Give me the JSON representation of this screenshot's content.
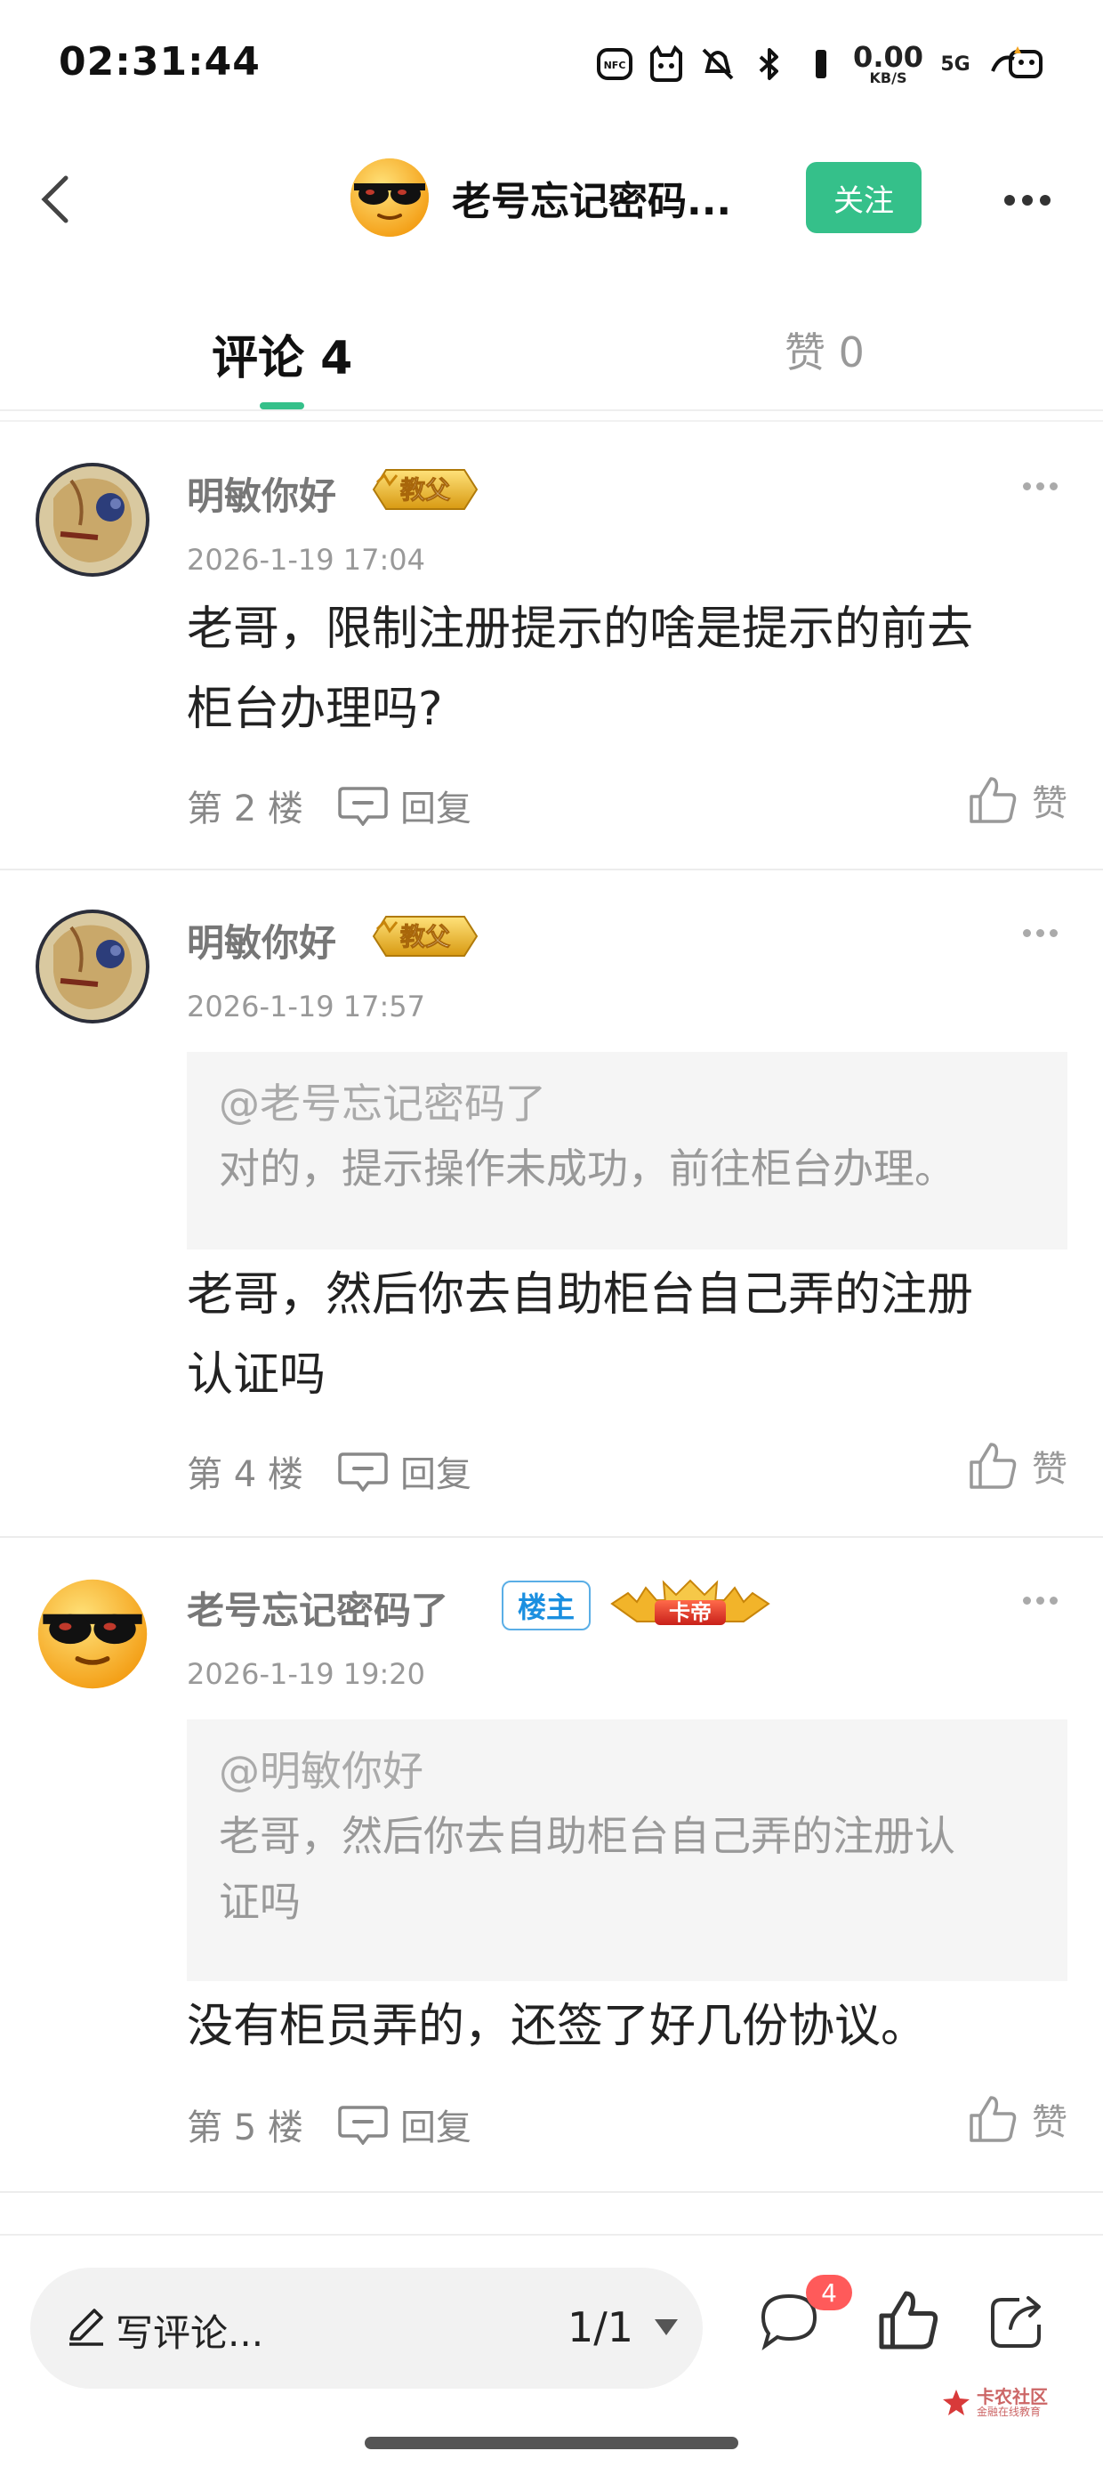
{
  "status_bar": {
    "time": "02:31:44",
    "nfc": "NFC",
    "net_speed": "0.00",
    "net_unit": "KB/S",
    "network": "5G",
    "icons": [
      "nfc-icon",
      "cat-icon",
      "mute-icon",
      "bluetooth-icon",
      "signal-icon",
      "battery-icon"
    ]
  },
  "header": {
    "title": "老号忘记密码...",
    "follow_label": "关注"
  },
  "tabs": {
    "comments_label": "评论 4",
    "likes_label": "赞 0"
  },
  "comments": [
    {
      "user": "明敏你好",
      "badge": "教父",
      "date": "2026-1-19 17:04",
      "content_line1": "老哥，限制注册提示的啥是提示的前去",
      "content_line2": "柜台办理吗?",
      "floor": "第 2 楼",
      "reply_label": "回复",
      "like_label": "赞"
    },
    {
      "user": "明敏你好",
      "badge": "教父",
      "date": "2026-1-19 17:57",
      "quote_user": "@老号忘记密码了",
      "quote_text": "对的，提示操作未成功，前往柜台办理。",
      "content_line1": "老哥，然后你去自助柜台自己弄的注册",
      "content_line2": "认证吗",
      "floor": "第 4 楼",
      "reply_label": "回复",
      "like_label": "赞"
    },
    {
      "user": "老号忘记密码了",
      "badge_owner": "楼主",
      "badge": "卡帝",
      "date": "2026-1-19 19:20",
      "quote_user": "@明敏你好",
      "quote_line1": "老哥，然后你去自助柜台自己弄的注册认",
      "quote_line2": "证吗",
      "content_line1": "没有柜员弄的，还签了好几份协议。",
      "floor": "第 5 楼",
      "reply_label": "回复",
      "like_label": "赞"
    }
  ],
  "bottom_bar": {
    "write_placeholder": "写评论...",
    "page_indicator": "1/1",
    "comment_count": "4",
    "watermark_title": "卡农社区",
    "watermark_sub": "金融在线教育"
  },
  "colors": {
    "accent": "#35c08a",
    "badge_red": "#ff5a5a",
    "owner_blue": "#1a8fe0"
  }
}
